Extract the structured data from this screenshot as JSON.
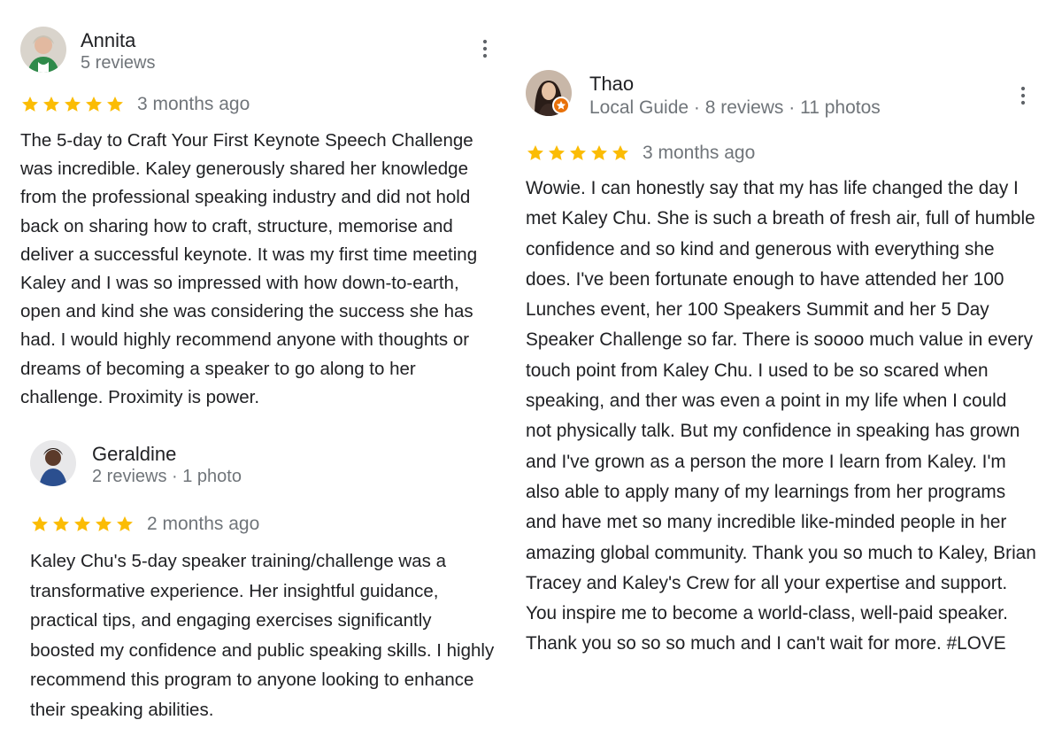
{
  "reviews": {
    "annita": {
      "name": "Annita",
      "meta": "5 reviews",
      "rating": 5,
      "date": "3 months ago",
      "text": "The 5-day to Craft Your First Keynote Speech Challenge was incredible. Kaley generously shared her knowledge from the professional speaking industry and did not hold back on sharing how to craft, structure, memorise and deliver a successful keynote. It was my first time meeting Kaley and I was so impressed with how down-to-earth, open and kind she was considering the success she has had. I would highly recommend anyone with thoughts or dreams of becoming a speaker to go along to her challenge. Proximity is power."
    },
    "geraldine": {
      "name": "Geraldine",
      "meta": "2 reviews · 1 photo",
      "rating": 5,
      "date": "2 months ago",
      "text": "Kaley Chu's 5-day speaker training/challenge was a transformative experience. Her insightful guidance, practical tips, and engaging exercises significantly boosted my confidence and public speaking skills. I highly recommend this program to anyone looking to enhance their speaking abilities."
    },
    "thao": {
      "name": "Thao",
      "meta": "Local Guide · 8 reviews · 11 photos",
      "rating": 5,
      "date": "3 months ago",
      "text": "Wowie. I can honestly say that my has life changed the day I met Kaley Chu. She is such a breath of fresh air, full of humble confidence and so kind and generous with everything she does. I've been fortunate enough to have attended her 100 Lunches event, her 100 Speakers Summit and her 5 Day Speaker Challenge so far. There is soooo much value in every touch point from Kaley Chu. I used to be so scared when speaking, and ther was even a point in my life when I could not physically talk. But my confidence in speaking has grown and I've grown as a person the more I learn from Kaley. I'm also able to apply many of my learnings from her programs and have met so many incredible like-minded people in her amazing global community. Thank you so much to Kaley, Brian Tracey and Kaley's Crew for all your expertise and support. You inspire me to become a world-class, well-paid speaker. Thank you so so so much and I can't wait for more. #LOVE"
    }
  },
  "colors": {
    "star": "#fbbc04",
    "text": "#202124",
    "secondary": "#70757a",
    "local_guide_badge": "#e8710a"
  },
  "icons": {
    "more": "more-vert-icon",
    "star": "star-icon",
    "badge": "local-guide-badge-icon"
  }
}
